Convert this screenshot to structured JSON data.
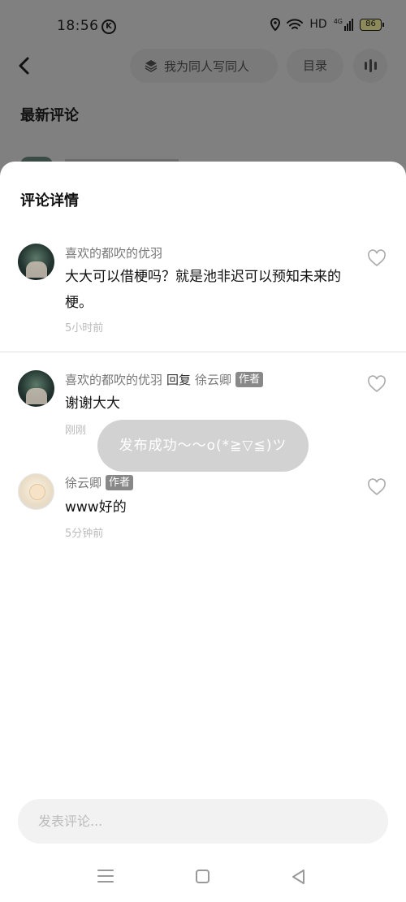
{
  "status_bar": {
    "time": "18:56",
    "k_icon": "K",
    "network": "HD",
    "signal": "4G",
    "battery": "86"
  },
  "top_bar": {
    "chapter_title": "我为同人写同人",
    "toc_label": "目录"
  },
  "background": {
    "section_title": "最新评论"
  },
  "sheet": {
    "title": "评论详情",
    "comments": [
      {
        "user": "喜欢的都吹的优羽",
        "text": "大大可以借梗吗？就是池非迟可以预知未来的梗。",
        "time": "5小时前"
      },
      {
        "user": "喜欢的都吹的优羽",
        "reply_word": "回复",
        "reply_to": "徐云卿",
        "author_badge": "作者",
        "text": "谢谢大大",
        "time": "刚刚"
      },
      {
        "user": "徐云卿",
        "author_badge": "作者",
        "text": "www好的",
        "time": "5分钟前"
      }
    ]
  },
  "toast": {
    "text": "发布成功～～o(*≧▽≦)ツ"
  },
  "input": {
    "placeholder": "发表评论..."
  },
  "icons": {
    "heart": "heart-icon",
    "back": "back-arrow-icon",
    "layers": "layers-icon",
    "audio": "audio-bars-icon"
  },
  "colors": {
    "overlay": "#808080",
    "badge": "#888888",
    "toast_bg": "#cdcdcd"
  }
}
